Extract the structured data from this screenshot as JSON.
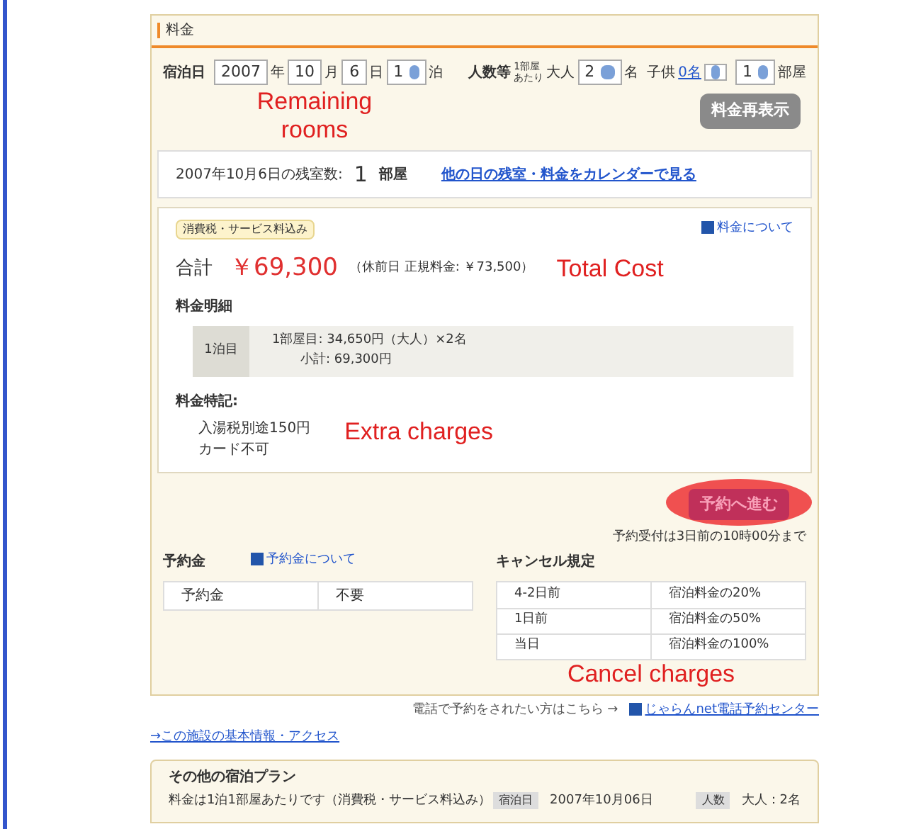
{
  "panel_title": "料金",
  "search": {
    "date_label": "宿泊日",
    "year": "2007",
    "year_unit": "年",
    "month": "10",
    "month_unit": "月",
    "day": "6",
    "day_unit": "日",
    "nights": "1",
    "nights_unit": "泊",
    "people_label": "人数等",
    "per_room": [
      "1部屋",
      "あたり"
    ],
    "adults_label": "大人",
    "adults": "2",
    "adults_unit": "名",
    "children_label": "子供",
    "children_link": "0名",
    "rooms": "1",
    "rooms_unit": "部屋",
    "refresh_button": "料金再表示"
  },
  "availability": {
    "label": "2007年10月6日の残室数:",
    "count": "1",
    "unit": "部屋",
    "calendar_link": "他の日の残室・料金をカレンダーで見る"
  },
  "price": {
    "tax_badge": "消費税・サービス料込み",
    "about_link": "料金について",
    "total_label": "合計",
    "total": "￥69,300",
    "note": "（休前日 正規料金: ￥73,500）",
    "breakdown_title": "料金明細",
    "night": "1泊目",
    "lines": [
      "1部屋目: 34,650円（大人）×2名",
      "小計: 69,300円"
    ],
    "special_title": "料金特記:",
    "special_lines": [
      "入湯税別途150円",
      "カード不可"
    ]
  },
  "reserve_button": "予約へ進む",
  "deadline": "予約受付は3日前の10時00分まで",
  "deposit": {
    "title": "予約金",
    "about_link": "予約金について",
    "rows": [
      [
        "予約金",
        "不要"
      ]
    ]
  },
  "cancel": {
    "title": "キャンセル規定",
    "rows": [
      [
        "4-2日前",
        "宿泊料金の20%"
      ],
      [
        "1日前",
        "宿泊料金の50%"
      ],
      [
        "当日",
        "宿泊料金の100%"
      ]
    ]
  },
  "phone": {
    "text": "電話で予約をされたい方はこちら →",
    "link": "じゃらんnet電話予約センター"
  },
  "facility_link": "→この施設の基本情報・アクセス",
  "other_plans": {
    "title": "その他の宿泊プラン",
    "note": "料金は1泊1部屋あたりです（消費税・サービス料込み）",
    "date_badge": "宿泊日",
    "date": "2007年10月06日",
    "people_badge": "人数",
    "people": "大人：2名"
  },
  "annotations": [
    {
      "kind": "rooms",
      "text": "Remaining rooms"
    },
    {
      "kind": "total",
      "text": "Total Cost"
    },
    {
      "kind": "extra",
      "text": "Extra charges"
    },
    {
      "kind": "cancel",
      "text": "Cancel charges"
    }
  ]
}
